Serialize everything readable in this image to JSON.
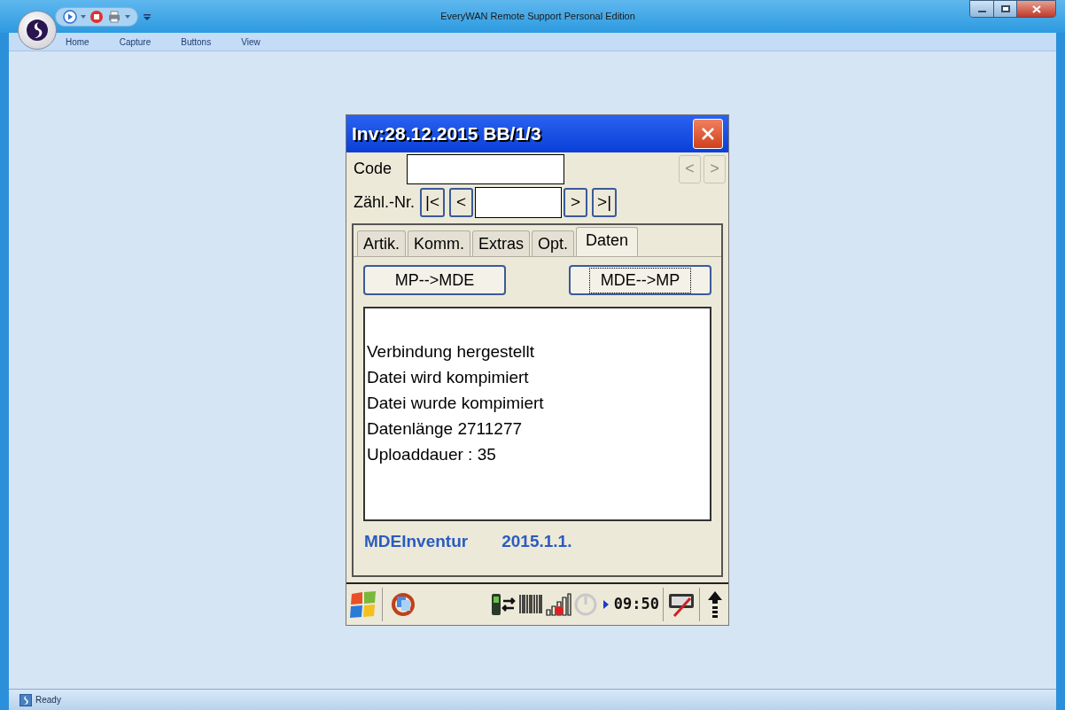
{
  "window": {
    "title": "EveryWAN Remote Support Personal Edition"
  },
  "menu": [
    {
      "label": "Home"
    },
    {
      "label": "Capture"
    },
    {
      "label": "Buttons"
    },
    {
      "label": "View"
    }
  ],
  "device": {
    "title": "Inv:28.12.2015 BB/1/3",
    "code_label": "Code",
    "side_buttons": [
      {
        "label": "<",
        "disabled": true
      },
      {
        "label": ">",
        "disabled": true
      }
    ],
    "count_label": "Zähl.-Nr.",
    "nav_buttons": [
      {
        "label": "|<",
        "kind": "button"
      },
      {
        "label": "<",
        "kind": "button"
      },
      {
        "kind": "field"
      },
      {
        "label": ">",
        "kind": "button"
      },
      {
        "label": ">|",
        "kind": "button"
      }
    ],
    "tabs": [
      {
        "label": "Artik.",
        "selected": false
      },
      {
        "label": "Komm.",
        "selected": false
      },
      {
        "label": "Extras",
        "selected": false
      },
      {
        "label": "Opt.",
        "selected": false
      },
      {
        "label": "Daten",
        "selected": true
      }
    ],
    "actions": [
      {
        "label": "MP-->MDE",
        "focused": false
      },
      {
        "label": "MDE-->MP",
        "focused": true
      }
    ],
    "log": [
      "Verbindung hergestellt",
      "Datei wird kompimiert",
      "Datei wurde kompimiert",
      "Datenlänge 2711277",
      "Uploaddauer : 35"
    ],
    "app_name": "MDEInventur",
    "version": "2015.1.1.",
    "clock": "09:50"
  },
  "status_bar": "Ready"
}
